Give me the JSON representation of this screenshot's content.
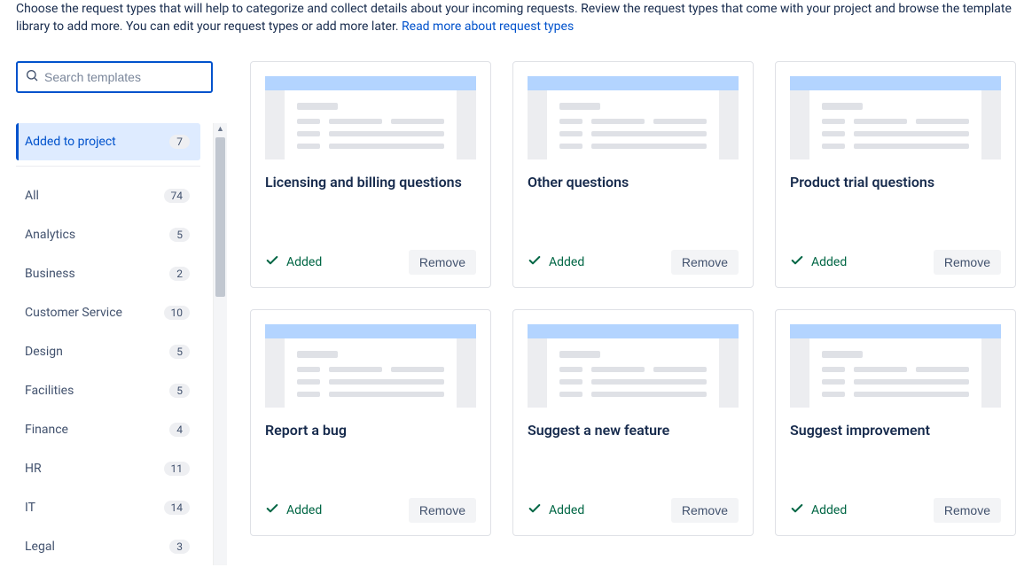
{
  "intro": {
    "text_before_link": "Choose the request types that will help to categorize and collect details about your incoming requests. Review the request types that come with your project and browse the template library to add more. You can edit your request types or add more later. ",
    "link_text": "Read more about request types"
  },
  "search": {
    "placeholder": "Search templates"
  },
  "sidebar": {
    "selected": {
      "label": "Added to project",
      "count": 7
    },
    "items": [
      {
        "label": "All",
        "count": 74
      },
      {
        "label": "Analytics",
        "count": 5
      },
      {
        "label": "Business",
        "count": 2
      },
      {
        "label": "Customer Service",
        "count": 10
      },
      {
        "label": "Design",
        "count": 5
      },
      {
        "label": "Facilities",
        "count": 5
      },
      {
        "label": "Finance",
        "count": 4
      },
      {
        "label": "HR",
        "count": 11
      },
      {
        "label": "IT",
        "count": 14
      },
      {
        "label": "Legal",
        "count": 3
      }
    ]
  },
  "cards": [
    {
      "title": "Licensing and billing questions",
      "added_label": "Added",
      "remove_label": "Remove"
    },
    {
      "title": "Other questions",
      "added_label": "Added",
      "remove_label": "Remove"
    },
    {
      "title": "Product trial questions",
      "added_label": "Added",
      "remove_label": "Remove"
    },
    {
      "title": "Report a bug",
      "added_label": "Added",
      "remove_label": "Remove"
    },
    {
      "title": "Suggest a new feature",
      "added_label": "Added",
      "remove_label": "Remove"
    },
    {
      "title": "Suggest improvement",
      "added_label": "Added",
      "remove_label": "Remove"
    }
  ]
}
